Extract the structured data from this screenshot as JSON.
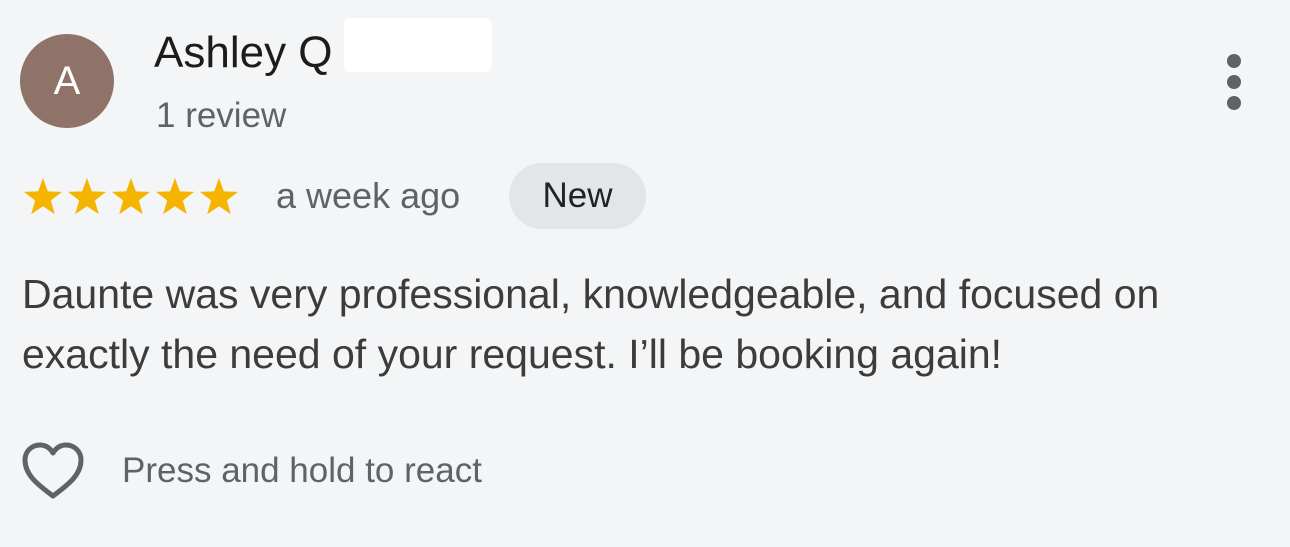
{
  "review": {
    "avatar_letter": "A",
    "avatar_color": "#8f7268",
    "author_name": "Ashley Q",
    "author_review_count": "1 review",
    "rating": 5,
    "rating_max": 5,
    "star_color": "#f4b400",
    "time_ago": "a week ago",
    "badge": "New",
    "text": "Daunte was very professional, knowledgeable, and focused on exactly the need of your request. I’ll be booking again!",
    "react_prompt": "Press and hold to react",
    "icons": {
      "more": "more-vertical-icon",
      "star": "star-icon",
      "react": "heart-outline-icon"
    }
  }
}
